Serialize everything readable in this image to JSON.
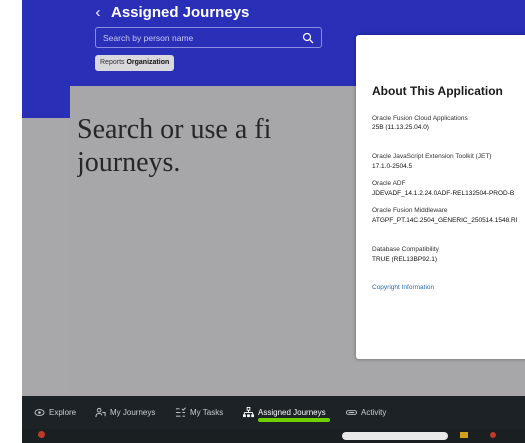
{
  "header": {
    "back_icon": "chevron-left-icon",
    "title": "Assigned Journeys",
    "search": {
      "placeholder": "Search by person name",
      "value": ""
    },
    "filter_chip": {
      "label": "Reports",
      "value": "Organization"
    }
  },
  "content": {
    "empty_message_line1": "Search or use a fi",
    "empty_message_line2": "journeys."
  },
  "about_dialog": {
    "title": "About This Application",
    "items": [
      {
        "label": "Oracle Fusion Cloud Applications",
        "value": "25B (11.13.25.04.0)"
      },
      {
        "label": "Oracle JavaScript Extension Toolkit (JET)",
        "value": "17.1.0-2504.5"
      },
      {
        "label": "Oracle ADF",
        "value": "JDEVADF_14.1.2.24.0ADF-REL132504-PROD-B"
      },
      {
        "label": "Oracle Fusion Middleware",
        "value": "ATGPF_PT.14C.2504_GENERIC_250514.1548.RI"
      },
      {
        "label": "Database Compatibility",
        "value": "TRUE (REL13BP92.1)"
      }
    ],
    "copyright_link": "Copyright Information"
  },
  "bottom_nav": {
    "items": [
      {
        "label": "Explore",
        "icon": "eye-icon"
      },
      {
        "label": "My Journeys",
        "icon": "person-path-icon"
      },
      {
        "label": "My Tasks",
        "icon": "task-list-icon"
      },
      {
        "label": "Assigned Journeys",
        "icon": "org-chart-icon",
        "active": true
      },
      {
        "label": "Activity",
        "icon": "activity-icon"
      }
    ]
  },
  "colors": {
    "header_bg": "#2a2fb8",
    "content_bg": "#a7a7a9",
    "nav_bg": "#1c2226",
    "active_accent": "#6fd000",
    "link": "#2b6cb0"
  }
}
